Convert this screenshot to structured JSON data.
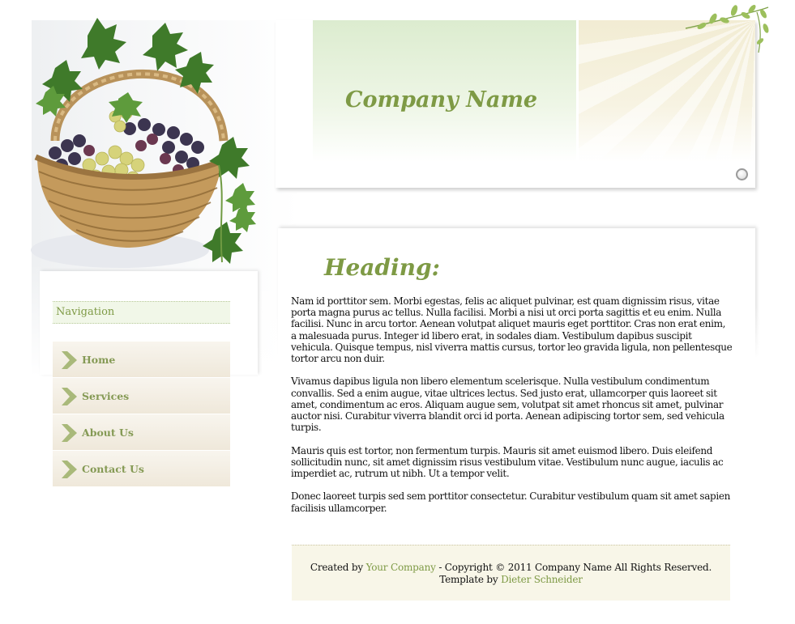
{
  "header": {
    "company_name": "Company Name"
  },
  "sidebar": {
    "title": "Navigation",
    "items": [
      {
        "label": "Home"
      },
      {
        "label": "Services"
      },
      {
        "label": "About Us"
      },
      {
        "label": "Contact Us"
      }
    ]
  },
  "content": {
    "heading": "Heading:",
    "paragraphs": [
      "Nam id porttitor sem. Morbi egestas, felis ac aliquet pulvinar, est quam dignissim risus, vitae porta magna purus ac tellus. Nulla facilisi. Morbi a nisi ut orci porta sagittis et eu enim. Nulla facilisi. Nunc in arcu tortor. Aenean volutpat aliquet mauris eget porttitor. Cras non erat enim, a malesuada purus. Integer id libero erat, in sodales diam. Vestibulum dapibus suscipit vehicula. Quisque tempus, nisl viverra mattis cursus, tortor leo gravida ligula, non pellentesque tortor arcu non duir.",
      "Vivamus dapibus ligula non libero elementum scelerisque. Nulla vestibulum condimentum convallis. Sed a enim augue, vitae ultrices lectus. Sed justo erat, ullamcorper quis laoreet sit amet, condimentum ac eros. Aliquam augue sem, volutpat sit amet rhoncus sit amet, pulvinar auctor nisi. Curabitur viverra blandit orci id porta. Aenean adipiscing tortor sem, sed vehicula turpis.",
      "Mauris quis est tortor, non fermentum turpis. Mauris sit amet euismod libero. Duis eleifend sollicitudin nunc, sit amet dignissim risus vestibulum vitae. Vestibulum nunc augue, iaculis ac imperdiet ac, rutrum ut nibh. Ut a tempor velit.",
      "Donec laoreet turpis sed sem porttitor consectetur. Curabitur vestibulum quam sit amet sapien facilisis ullamcorper."
    ]
  },
  "footer": {
    "created_by": "Created by",
    "company_link": "Your Company",
    "copyright": "- Copyright © 2011 Company Name All Rights Reserved.",
    "template_by": "Template by",
    "author_link": "Dieter Schneider"
  },
  "icons": {
    "nav_arrow": "chevron-right-icon",
    "header_knob": "circle-icon",
    "basket": "grape-basket-illustration",
    "vine": "vine-decoration"
  },
  "colors": {
    "accent_green": "#7e9a45",
    "nav_text": "#859a55",
    "footer_bg": "#f8f6e8"
  }
}
